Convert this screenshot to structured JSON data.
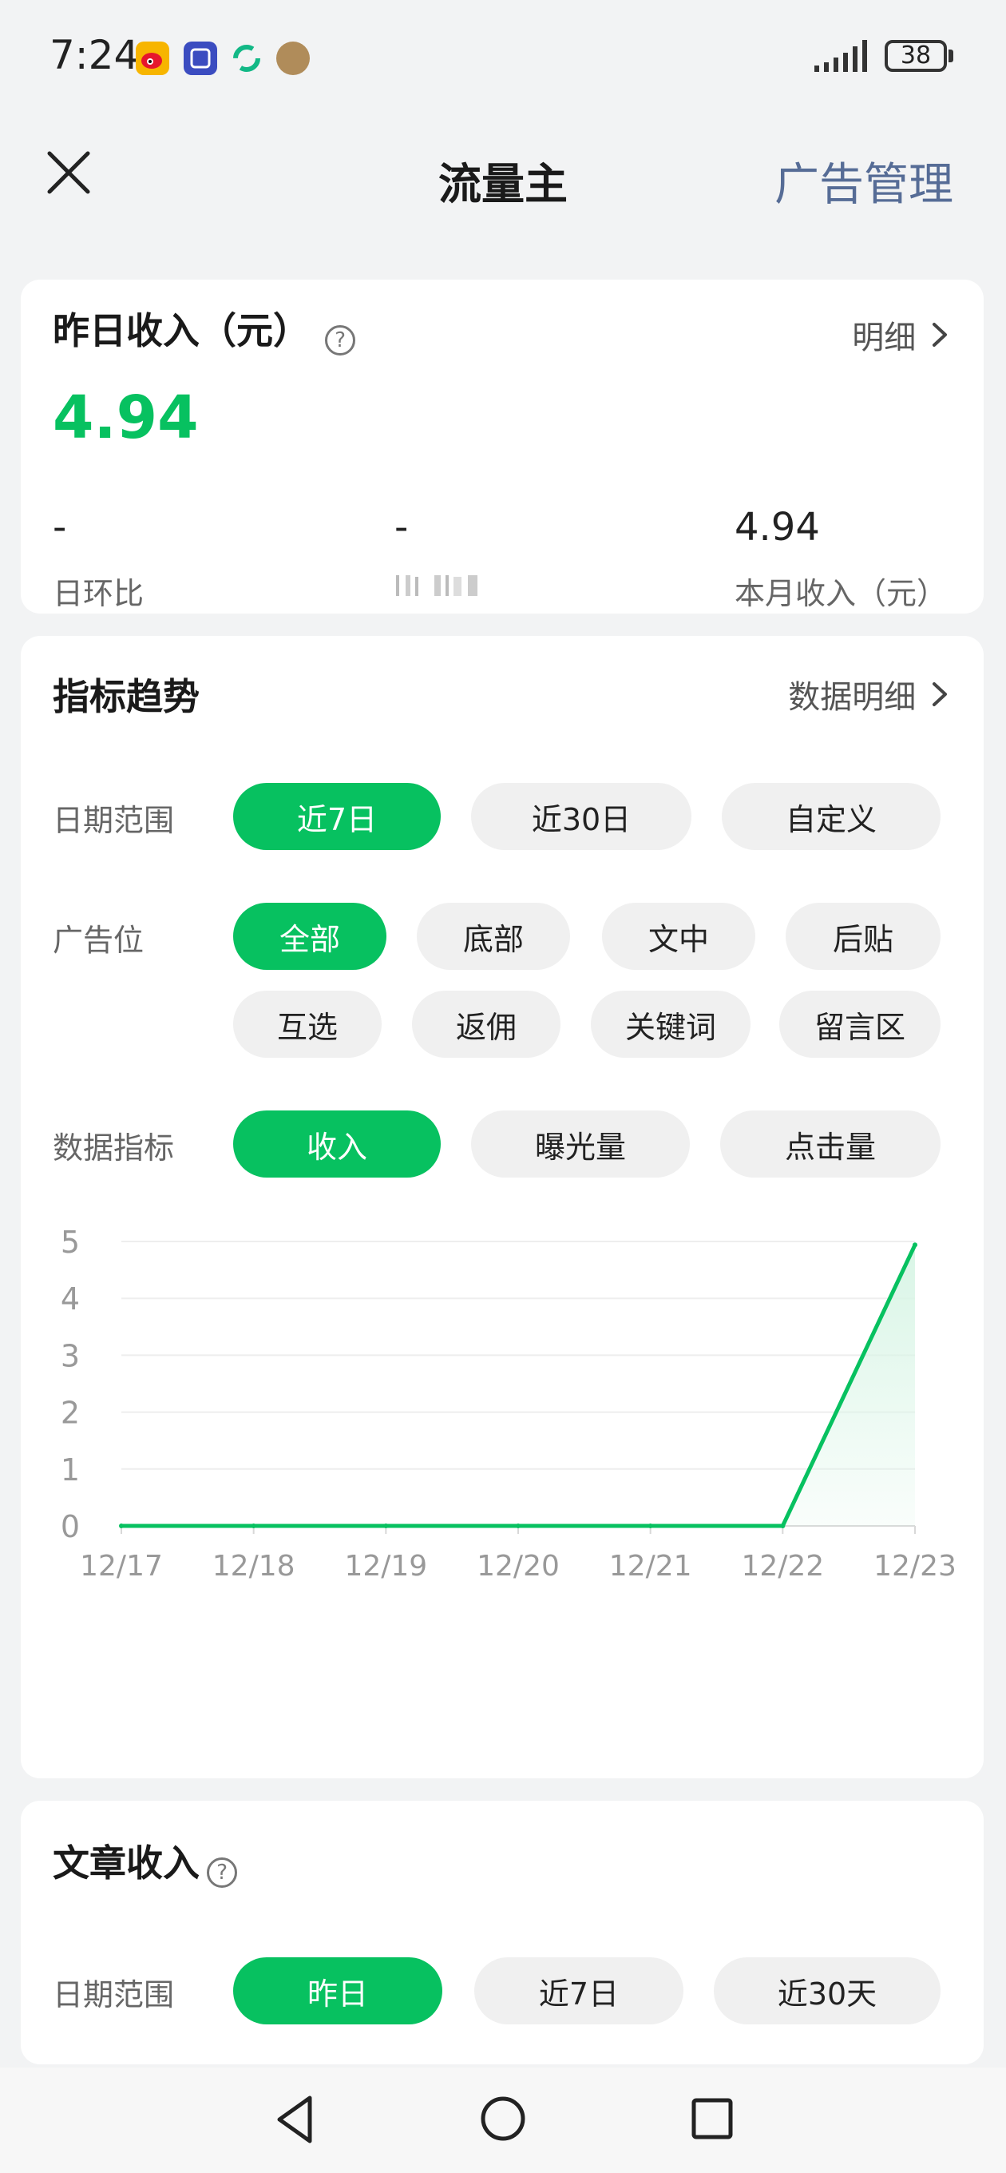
{
  "status": {
    "time": "7:24",
    "battery": "38"
  },
  "header": {
    "title": "流量主",
    "right_action": "广告管理"
  },
  "income_card": {
    "title": "昨日收入（元）",
    "detail_link": "明细",
    "amount": "4.94",
    "stats": [
      {
        "value": "-",
        "label": "日环比"
      },
      {
        "value": "-",
        "label": ""
      },
      {
        "value": "4.94",
        "label": "本月收入（元）"
      }
    ]
  },
  "trend_card": {
    "title": "指标趋势",
    "detail_link": "数据明细",
    "date_range": {
      "label": "日期范围",
      "options": [
        "近7日",
        "近30日",
        "自定义"
      ],
      "selected": 0
    },
    "ad_slot": {
      "label": "广告位",
      "options": [
        "全部",
        "底部",
        "文中",
        "后贴",
        "互选",
        "返佣",
        "关键词",
        "留言区"
      ],
      "selected": 0
    },
    "metric": {
      "label": "数据指标",
      "options": [
        "收入",
        "曝光量",
        "点击量"
      ],
      "selected": 0
    }
  },
  "chart_data": {
    "type": "area",
    "categories": [
      "12/17",
      "12/18",
      "12/19",
      "12/20",
      "12/21",
      "12/22",
      "12/23"
    ],
    "values": [
      0,
      0,
      0,
      0,
      0,
      0,
      4.94
    ],
    "ylim": [
      0,
      5
    ],
    "yticks": [
      0,
      1,
      2,
      3,
      4,
      5
    ],
    "grid": true,
    "color": "#07c160",
    "fill_color": "#d9f5e6"
  },
  "article_card": {
    "title": "文章收入",
    "date_range": {
      "label": "日期范围",
      "options": [
        "昨日",
        "近7日",
        "近30天"
      ],
      "selected": 0
    }
  },
  "colors": {
    "accent": "#07c160",
    "link_blue": "#566c96",
    "background": "#f2f3f4"
  }
}
